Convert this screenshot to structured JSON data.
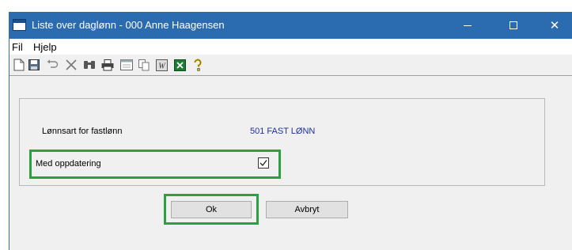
{
  "window": {
    "title": "Liste over daglønn - 000 Anne Haagensen",
    "controls": {
      "minimize": "—",
      "maximize": "☐",
      "close": "✕"
    }
  },
  "menu": {
    "items": [
      "Fil",
      "Hjelp"
    ]
  },
  "toolbar": {
    "icons": [
      "new-document-icon",
      "save-icon",
      "undo-icon",
      "delete-icon",
      "find-icon",
      "print-icon",
      "preview-icon",
      "copy-icon",
      "word-export-icon",
      "excel-export-icon",
      "help-icon"
    ]
  },
  "form": {
    "fastlonn_label": "Lønnsart for fastlønn",
    "fastlonn_value": "501  FAST LØNN",
    "oppdatering_label": "Med oppdatering",
    "oppdatering_checked": true
  },
  "buttons": {
    "ok": "Ok",
    "cancel": "Avbryt"
  },
  "colors": {
    "titlebar": "#2b6cb0",
    "highlight": "#2aa13f",
    "value_text": "#1f2f9a"
  }
}
